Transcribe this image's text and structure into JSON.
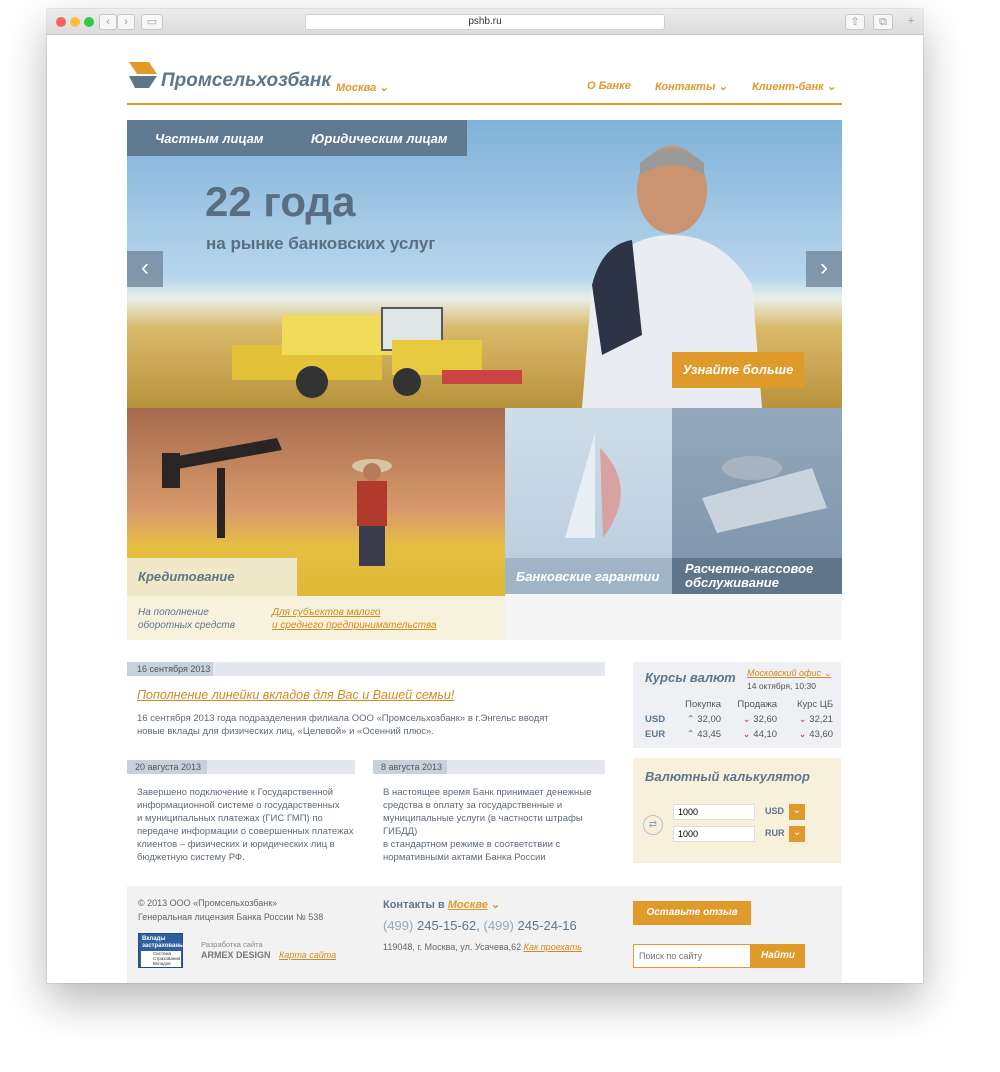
{
  "browser": {
    "url": "pshb.ru"
  },
  "header": {
    "logo": "Промсельхозбанк",
    "city": "Москва",
    "nav": [
      "О Банке",
      "Контакты",
      "Клиент-банк"
    ]
  },
  "hero": {
    "tabs": [
      "Частным лицам",
      "Юридическим лицам"
    ],
    "title": "22 года",
    "subtitle": "на рынке банковских услуг",
    "cta": "Узнайте больше"
  },
  "tiles": {
    "credit": "Кредитование",
    "credit_link1": "На пополнение\nоборотных средств",
    "credit_link2": "Для субъектов малого\nи среднего предпринимательства",
    "guarantees": "Банковские гарантии",
    "cash": "Расчетно-кассовое\nобслуживание"
  },
  "news": {
    "main": {
      "date": "16 сентября 2013",
      "title": "Пополнение линейки вкладов для Вас и Вашей семьи!",
      "text": "16 сентября 2013 года подразделения филиала ООО «Промсельхозбанк» в г.Энгельс вводят\nновые вклады для физических лиц, «Целевой» и «Осенний плюс»."
    },
    "left": {
      "date": "20 августа 2013",
      "text": "Завершено подключение к Государственной\nинформационной системе о государственных\nи муниципальных платежах (ГИС ГМП) по\nпередаче информации о совершенных платежах\nклиентов – физических и юридических лиц в\nбюджетную систему РФ."
    },
    "right": {
      "date": "8 августа 2013",
      "text": "В настоящее время Банк принимает денежные\nсредства в оплату за государственные и\nмуниципальные услуги (в частности штрафы ГИБДД)\nв стандартном режиме в соответствии с\nнормативными актами Банка России"
    }
  },
  "rates": {
    "title": "Курсы валют",
    "office": "Московский офис",
    "date": "14 октября, 10:30",
    "cols": [
      "Покупка",
      "Продажа",
      "Курс ЦБ"
    ],
    "rows": [
      {
        "cur": "USD",
        "buy": "32,00",
        "sell": "32,60",
        "cb": "32,21"
      },
      {
        "cur": "EUR",
        "buy": "43,45",
        "sell": "44,10",
        "cb": "43,60"
      }
    ]
  },
  "calc": {
    "title": "Валютный калькулятор",
    "v1": "1000",
    "c1": "USD",
    "v2": "1000",
    "c2": "RUR"
  },
  "footer": {
    "copy": "© 2013 ООО «Промсельхозбанк»",
    "license": "Генеральная лицензия Банка России № 538",
    "dev": "Разработка сайта",
    "dev_name": "ARMEX DESIGN",
    "map": "Карта сайта",
    "contacts_label": "Контакты в",
    "contacts_city": "Москве",
    "phone1_code": "(499)",
    "phone1": "245-15-62,",
    "phone2_code": "(499)",
    "phone2": "245-24-16",
    "address": "119048, г. Москва, ул. Усачева,62",
    "route": "Как проехать",
    "feedback": "Оставьте отзыв",
    "search_ph": "Поиск по сайту",
    "search_btn": "Найти",
    "badge": "Вклады\nзастрахованы",
    "badge_sub": "Система\nСтрахования\nВкладов"
  },
  "colors": {
    "accent": "#e09a2c",
    "slate": "#5f7589"
  }
}
